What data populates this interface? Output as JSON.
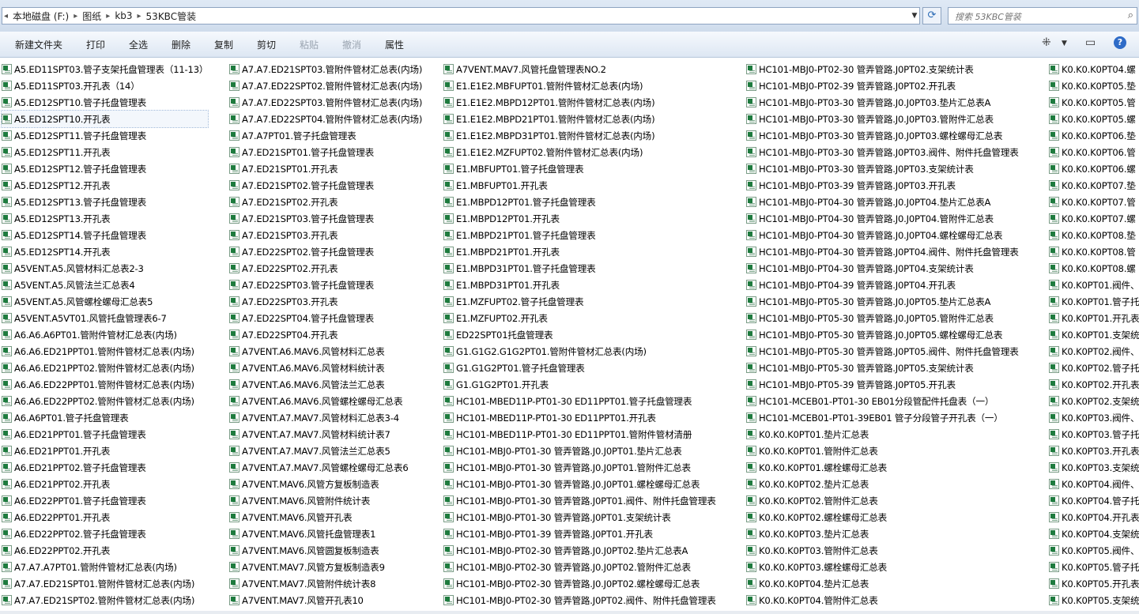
{
  "address": {
    "breadcrumbs": [
      "本地磁盘 (F:)",
      "图纸",
      "kb3",
      "53KBC管装"
    ],
    "search_placeholder": "搜索 53KBC管装"
  },
  "toolbar": {
    "new_folder": "新建文件夹",
    "print": "打印",
    "select_all": "全选",
    "delete": "删除",
    "copy": "复制",
    "cut": "剪切",
    "paste": "粘贴",
    "undo": "撤消",
    "properties": "属性"
  },
  "columns": [
    [
      "A5.ED11SPT03.管子支架托盘管理表（11-13）",
      "A5.ED11SPT03.开孔表（14）",
      "A5.ED12SPT10.管子托盘管理表",
      "A5.ED12SPT10.开孔表",
      "A5.ED12SPT11.管子托盘管理表",
      "A5.ED12SPT11.开孔表",
      "A5.ED12SPT12.管子托盘管理表",
      "A5.ED12SPT12.开孔表",
      "A5.ED12SPT13.管子托盘管理表",
      "A5.ED12SPT13.开孔表",
      "A5.ED12SPT14.管子托盘管理表",
      "A5.ED12SPT14.开孔表",
      "A5VENT.A5.风管材料汇总表2-3",
      "A5VENT.A5.风管法兰汇总表4",
      "A5VENT.A5.风管螺栓螺母汇总表5",
      "A5VENT.A5VT01.风管托盘管理表6-7",
      "A6.A6.A6PT01.管附件管材汇总表(内场)",
      "A6.A6.ED21PPT01.管附件管材汇总表(内场)",
      "A6.A6.ED21PPT02.管附件管材汇总表(内场)",
      "A6.A6.ED22PPT01.管附件管材汇总表(内场)",
      "A6.A6.ED22PPT02.管附件管材汇总表(内场)",
      "A6.A6PT01.管子托盘管理表",
      "A6.ED21PPT01.管子托盘管理表",
      "A6.ED21PPT01.开孔表",
      "A6.ED21PPT02.管子托盘管理表",
      "A6.ED21PPT02.开孔表",
      "A6.ED22PPT01.管子托盘管理表",
      "A6.ED22PPT01.开孔表",
      "A6.ED22PPT02.管子托盘管理表",
      "A6.ED22PPT02.开孔表",
      "A7.A7.A7PT01.管附件管材汇总表(内场)",
      "A7.A7.ED21SPT01.管附件管材汇总表(内场)",
      "A7.A7.ED21SPT02.管附件管材汇总表(内场)"
    ],
    [
      "A7.A7.ED21SPT03.管附件管材汇总表(内场)",
      "A7.A7.ED22SPT02.管附件管材汇总表(内场)",
      "A7.A7.ED22SPT03.管附件管材汇总表(内场)",
      "A7.A7.ED22SPT04.管附件管材汇总表(内场)",
      "A7.A7PT01.管子托盘管理表",
      "A7.ED21SPT01.管子托盘管理表",
      "A7.ED21SPT01.开孔表",
      "A7.ED21SPT02.管子托盘管理表",
      "A7.ED21SPT02.开孔表",
      "A7.ED21SPT03.管子托盘管理表",
      "A7.ED21SPT03.开孔表",
      "A7.ED22SPT02.管子托盘管理表",
      "A7.ED22SPT02.开孔表",
      "A7.ED22SPT03.管子托盘管理表",
      "A7.ED22SPT03.开孔表",
      "A7.ED22SPT04.管子托盘管理表",
      "A7.ED22SPT04.开孔表",
      "A7VENT.A6.MAV6.风管材料汇总表",
      "A7VENT.A6.MAV6.风管材料统计表",
      "A7VENT.A6.MAV6.风管法兰汇总表",
      "A7VENT.A6.MAV6.风管螺栓螺母汇总表",
      "A7VENT.A7.MAV7.风管材料汇总表3-4",
      "A7VENT.A7.MAV7.风管材料统计表7",
      "A7VENT.A7.MAV7.风管法兰汇总表5",
      "A7VENT.A7.MAV7.风管螺栓螺母汇总表6",
      "A7VENT.MAV6.风管方复板制造表",
      "A7VENT.MAV6.风管附件统计表",
      "A7VENT.MAV6.风管开孔表",
      "A7VENT.MAV6.风管托盘管理表1",
      "A7VENT.MAV6.风管圆复板制造表",
      "A7VENT.MAV7.风管方复板制造表9",
      "A7VENT.MAV7.风管附件统计表8",
      "A7VENT.MAV7.风管开孔表10"
    ],
    [
      "A7VENT.MAV7.风管托盘管理表NO.2",
      "E1.E1E2.MBFUPT01.管附件管材汇总表(内场)",
      "E1.E1E2.MBPD12PT01.管附件管材汇总表(内场)",
      "E1.E1E2.MBPD21PT01.管附件管材汇总表(内场)",
      "E1.E1E2.MBPD31PT01.管附件管材汇总表(内场)",
      "E1.E1E2.MZFUPT02.管附件管材汇总表(内场)",
      "E1.MBFUPT01.管子托盘管理表",
      "E1.MBFUPT01.开孔表",
      "E1.MBPD12PT01.管子托盘管理表",
      "E1.MBPD12PT01.开孔表",
      "E1.MBPD21PT01.管子托盘管理表",
      "E1.MBPD21PT01.开孔表",
      "E1.MBPD31PT01.管子托盘管理表",
      "E1.MBPD31PT01.开孔表",
      "E1.MZFUPT02.管子托盘管理表",
      "E1.MZFUPT02.开孔表",
      "ED22SPT01托盘管理表",
      "G1.G1G2.G1G2PT01.管附件管材汇总表(内场)",
      "G1.G1G2PT01.管子托盘管理表",
      "G1.G1G2PT01.开孔表",
      "HC101-MBED11P-PT01-30    ED11PPT01.管子托盘管理表",
      "HC101-MBED11P-PT01-30    ED11PPT01.开孔表",
      "HC101-MBED11P-PT01-30   ED11PPT01.管附件管材清册",
      "HC101-MBJ0-PT01-30 管弄管路.J0.J0PT01.垫片汇总表",
      "HC101-MBJ0-PT01-30 管弄管路.J0.J0PT01.管附件汇总表",
      "HC101-MBJ0-PT01-30 管弄管路.J0.J0PT01.螺栓螺母汇总表",
      "HC101-MBJ0-PT01-30 管弄管路.J0PT01.阀件、附件托盘管理表",
      "HC101-MBJ0-PT01-30 管弄管路.J0PT01.支架统计表",
      "HC101-MBJ0-PT01-39 管弄管路.J0PT01.开孔表",
      "HC101-MBJ0-PT02-30 管弄管路.J0.J0PT02.垫片汇总表A",
      "HC101-MBJ0-PT02-30 管弄管路.J0.J0PT02.管附件汇总表",
      "HC101-MBJ0-PT02-30 管弄管路.J0.J0PT02.螺栓螺母汇总表",
      "HC101-MBJ0-PT02-30 管弄管路.J0PT02.阀件、附件托盘管理表"
    ],
    [
      "HC101-MBJ0-PT02-30 管弄管路.J0PT02.支架统计表",
      "HC101-MBJ0-PT02-39 管弄管路.J0PT02.开孔表",
      "HC101-MBJ0-PT03-30 管弄管路.J0.J0PT03.垫片汇总表A",
      "HC101-MBJ0-PT03-30 管弄管路.J0.J0PT03.管附件汇总表",
      "HC101-MBJ0-PT03-30 管弄管路.J0.J0PT03.螺栓螺母汇总表",
      "HC101-MBJ0-PT03-30 管弄管路.J0PT03.阀件、附件托盘管理表",
      "HC101-MBJ0-PT03-30 管弄管路.J0PT03.支架统计表",
      "HC101-MBJ0-PT03-39 管弄管路.J0PT03.开孔表",
      "HC101-MBJ0-PT04-30 管弄管路.J0.J0PT04.垫片汇总表A",
      "HC101-MBJ0-PT04-30 管弄管路.J0.J0PT04.管附件汇总表",
      "HC101-MBJ0-PT04-30 管弄管路.J0.J0PT04.螺栓螺母汇总表",
      "HC101-MBJ0-PT04-30 管弄管路.J0PT04.阀件、附件托盘管理表",
      "HC101-MBJ0-PT04-30 管弄管路.J0PT04.支架统计表",
      "HC101-MBJ0-PT04-39 管弄管路.J0PT04.开孔表",
      "HC101-MBJ0-PT05-30 管弄管路.J0.J0PT05.垫片汇总表A",
      "HC101-MBJ0-PT05-30 管弄管路.J0.J0PT05.管附件汇总表",
      "HC101-MBJ0-PT05-30 管弄管路.J0.J0PT05.螺栓螺母汇总表",
      "HC101-MBJ0-PT05-30 管弄管路.J0PT05.阀件、附件托盘管理表",
      "HC101-MBJ0-PT05-30 管弄管路.J0PT05.支架统计表",
      "HC101-MBJ0-PT05-39 管弄管路.J0PT05.开孔表",
      "HC101-MCEB01-PT01-30   EB01分段管配件托盘表（一）",
      "HC101-MCEB01-PT01-39EB01   管子分段管子开孔表（一）",
      "K0.K0.K0PT01.垫片汇总表",
      "K0.K0.K0PT01.管附件汇总表",
      "K0.K0.K0PT01.螺栓螺母汇总表",
      "K0.K0.K0PT02.垫片汇总表",
      "K0.K0.K0PT02.管附件汇总表",
      "K0.K0.K0PT02.螺栓螺母汇总表",
      "K0.K0.K0PT03.垫片汇总表",
      "K0.K0.K0PT03.管附件汇总表",
      "K0.K0.K0PT03.螺栓螺母汇总表",
      "K0.K0.K0PT04.垫片汇总表",
      "K0.K0.K0PT04.管附件汇总表"
    ],
    [
      "K0.K0.K0PT04.螺",
      "K0.K0.K0PT05.垫",
      "K0.K0.K0PT05.管",
      "K0.K0.K0PT05.螺",
      "K0.K0.K0PT06.垫",
      "K0.K0.K0PT06.管",
      "K0.K0.K0PT06.螺",
      "K0.K0.K0PT07.垫",
      "K0.K0.K0PT07.管",
      "K0.K0.K0PT07.螺",
      "K0.K0.K0PT08.垫",
      "K0.K0.K0PT08.管",
      "K0.K0.K0PT08.螺",
      "K0.K0PT01.阀件、",
      "K0.K0PT01.管子托",
      "K0.K0PT01.开孔表",
      "K0.K0PT01.支架统",
      "K0.K0PT02.阀件、",
      "K0.K0PT02.管子托",
      "K0.K0PT02.开孔表",
      "K0.K0PT02.支架统",
      "K0.K0PT03.阀件、",
      "K0.K0PT03.管子托",
      "K0.K0PT03.开孔表",
      "K0.K0PT03.支架统",
      "K0.K0PT04.阀件、",
      "K0.K0PT04.管子托",
      "K0.K0PT04.开孔表",
      "K0.K0PT04.支架统",
      "K0.K0PT05.阀件、",
      "K0.K0PT05.管子托",
      "K0.K0PT05.开孔表",
      "K0.K0PT05.支架统"
    ]
  ],
  "colors": {
    "excel_icon": "#1e7b3e",
    "toolbar_bg": "#dde7f3"
  }
}
